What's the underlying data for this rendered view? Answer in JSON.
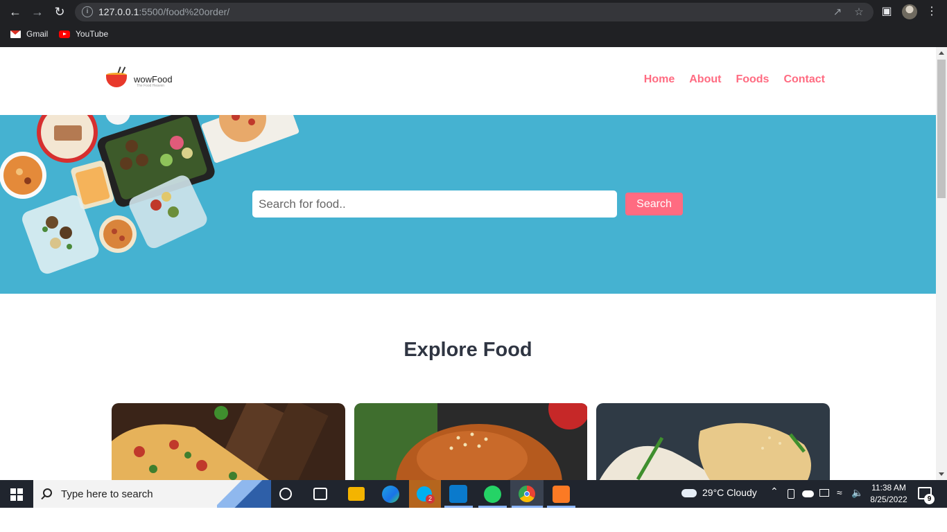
{
  "browser": {
    "url_host": "127.0.0.1",
    "url_path": ":5500/food%20order/",
    "bookmarks": [
      {
        "label": "Gmail",
        "icon": "gmail-icon"
      },
      {
        "label": "YouTube",
        "icon": "youtube-icon"
      }
    ]
  },
  "site": {
    "logo_name": "wowFood",
    "logo_tagline": "The Food Heaven",
    "nav": [
      {
        "label": "Home"
      },
      {
        "label": "About"
      },
      {
        "label": "Foods"
      },
      {
        "label": "Contact"
      }
    ],
    "search": {
      "placeholder": "Search for food..",
      "button_label": "Search"
    },
    "explore_title": "Explore Food",
    "accent_color": "#ff6b81",
    "hero_color": "#45b2d1"
  },
  "taskbar": {
    "search_placeholder": "Type here to search",
    "weather": "29°C  Cloudy",
    "time": "11:38 AM",
    "date": "8/25/2022",
    "notifications": "9",
    "skype_badge": "2"
  }
}
